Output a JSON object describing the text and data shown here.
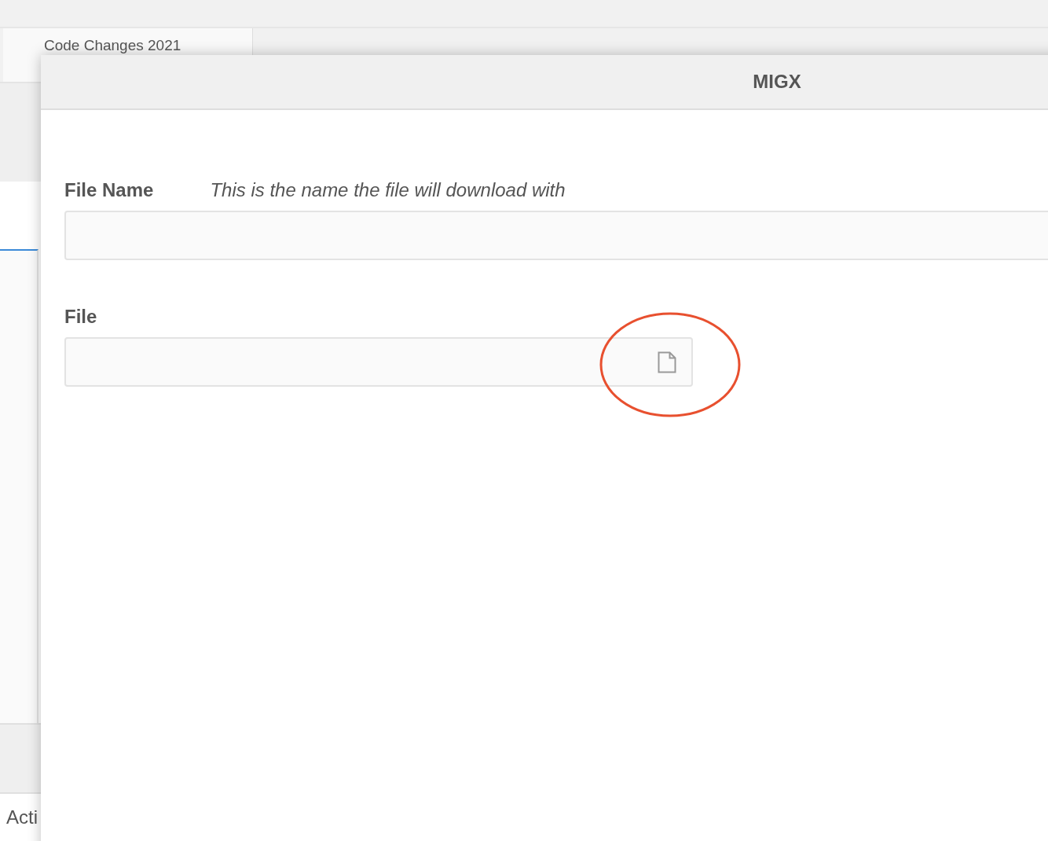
{
  "background": {
    "breadcrumb": "Code Changes 2021",
    "footer_text": "Acti"
  },
  "modal": {
    "title": "MIGX",
    "fields": [
      {
        "kind": "text",
        "label": "File Name",
        "hint": "This is the name the file will download with"
      },
      {
        "kind": "file",
        "label": "File"
      }
    ]
  }
}
